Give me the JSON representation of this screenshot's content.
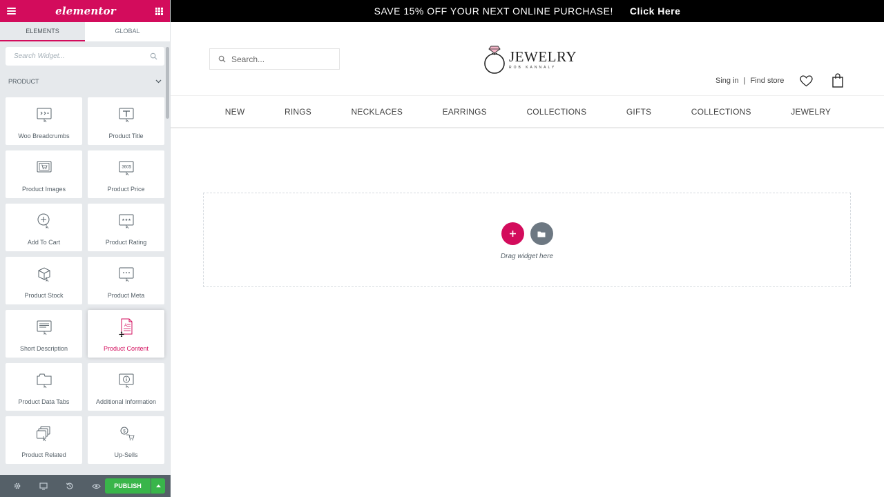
{
  "panel": {
    "brand": "elementor",
    "tabs": [
      {
        "label": "ELEMENTS",
        "active": true
      },
      {
        "label": "GLOBAL",
        "active": false
      }
    ],
    "search_placeholder": "Search Widget...",
    "category": "PRODUCT",
    "widgets": [
      {
        "label": "Woo Breadcrumbs",
        "icon": "breadcrumbs-icon"
      },
      {
        "label": "Product Title",
        "icon": "title-icon"
      },
      {
        "label": "Product Images",
        "icon": "product-images-icon"
      },
      {
        "label": "Product Price",
        "icon": "price-icon"
      },
      {
        "label": "Add To Cart",
        "icon": "add-to-cart-icon"
      },
      {
        "label": "Product Rating",
        "icon": "rating-icon"
      },
      {
        "label": "Product Stock",
        "icon": "stock-icon"
      },
      {
        "label": "Product Meta",
        "icon": "meta-icon"
      },
      {
        "label": "Short Description",
        "icon": "short-description-icon"
      },
      {
        "label": "Product Content",
        "icon": "content-icon",
        "hovered": true
      },
      {
        "label": "Product Data Tabs",
        "icon": "data-tabs-icon"
      },
      {
        "label": "Additional Information",
        "icon": "info-icon"
      },
      {
        "label": "Product Related",
        "icon": "related-icon"
      },
      {
        "label": "Up-Sells",
        "icon": "upsells-icon"
      }
    ],
    "price_icon_text": "360$",
    "footer": {
      "publish_label": "PUBLISH"
    }
  },
  "site": {
    "promo_text": "SAVE 15% OFF YOUR NEXT ONLINE PURCHASE!",
    "promo_link": "Click Here",
    "search_placeholder": "Search...",
    "logo_main": "JEWELRY",
    "logo_sub": "ROB KANNALY",
    "sign_in": "Sing in",
    "find_store": "Find store",
    "nav": [
      "NEW",
      "RINGS",
      "NECKLACES",
      "EARRINGS",
      "COLLECTIONS",
      "GIFTS",
      "COLLECTIONS",
      "JEWELRY"
    ],
    "drop_text": "Drag widget here"
  },
  "colors": {
    "accent": "#d30c5c",
    "publish": "#39b54a",
    "panel_bg": "#e6e9ec",
    "footer_bg": "#556068"
  }
}
